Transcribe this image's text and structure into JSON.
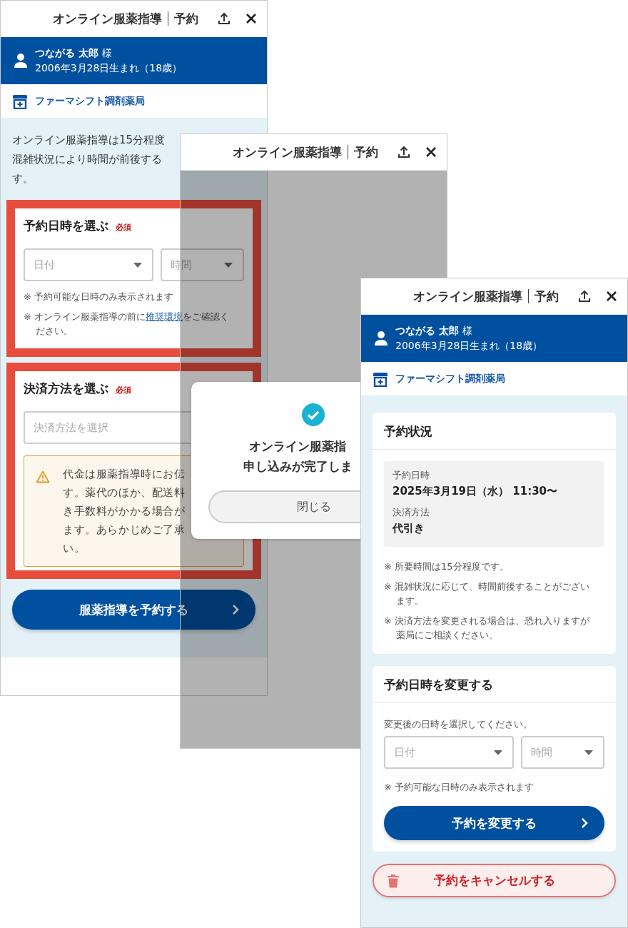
{
  "booking_screen": {
    "header": {
      "title": "オンライン服薬指導",
      "subtitle": "予約"
    },
    "patient": {
      "name": "つながる 太郎",
      "honorific": "様",
      "birth": "2006年3月28日生まれ（18歳）"
    },
    "pharmacy": "ファーマシフト調剤薬局",
    "intro_lines": [
      "オンライン服薬指導は15分程度",
      "混雑状況により時間が前後する",
      "す。"
    ],
    "date_section": {
      "title": "予約日時を選ぶ",
      "badge": "必須",
      "date_select": {
        "placeholder": "日付"
      },
      "time_select": {
        "placeholder": "時間"
      },
      "notes": [
        {
          "text": "※ 予約可能な日時のみ表示されます"
        },
        {
          "text": "※ オンライン服薬指導の前に",
          "link": "推奨環境",
          "after": "をご確認ください。"
        }
      ]
    },
    "payment_section": {
      "title": "決済方法を選ぶ",
      "badge": "必須",
      "payment_select": {
        "placeholder": "決済方法を選択"
      },
      "warning_lines": [
        "代金は服薬指導時にお伝",
        "す。薬代のほか、配送料",
        "き手数料がかかる場合が",
        "ます。あらかじめご了承",
        "い。"
      ]
    },
    "submit_button": "服薬指導を予約する"
  },
  "confirmation_screen": {
    "header": {
      "title": "オンライン服薬指導",
      "subtitle": "予約"
    },
    "dialog": {
      "title_lines": [
        "オンライン服薬指",
        "申し込みが完了しま"
      ],
      "close_button": "閉じる"
    }
  },
  "status_screen": {
    "header": {
      "title": "オンライン服薬指導",
      "subtitle": "予約"
    },
    "patient": {
      "name": "つながる 太郎",
      "honorific": "様",
      "birth": "2006年3月28日生まれ（18歳）"
    },
    "pharmacy": "ファーマシフト調剤薬局",
    "status_card": {
      "title": "予約状況",
      "fields": [
        {
          "label": "予約日時",
          "value": "2025年3月19日（水） 11:30〜"
        },
        {
          "label": "決済方法",
          "value": "代引き"
        }
      ],
      "notes": [
        "※ 所要時間は15分程度です。",
        "※ 混雑状況に応じて、時間前後することがございます。",
        "※ 決済方法を変更される場合は、恐れ入りますが薬局にご相談ください。"
      ]
    },
    "change_card": {
      "title": "予約日時を変更する",
      "instruction": "変更後の日時を選択してください。",
      "date_select": {
        "placeholder": "日付"
      },
      "time_select": {
        "placeholder": "時間"
      },
      "note": "※ 予約可能な日時のみ表示されます",
      "submit_button": "予約を変更する"
    },
    "cancel_button": "予約をキャンセルする"
  }
}
